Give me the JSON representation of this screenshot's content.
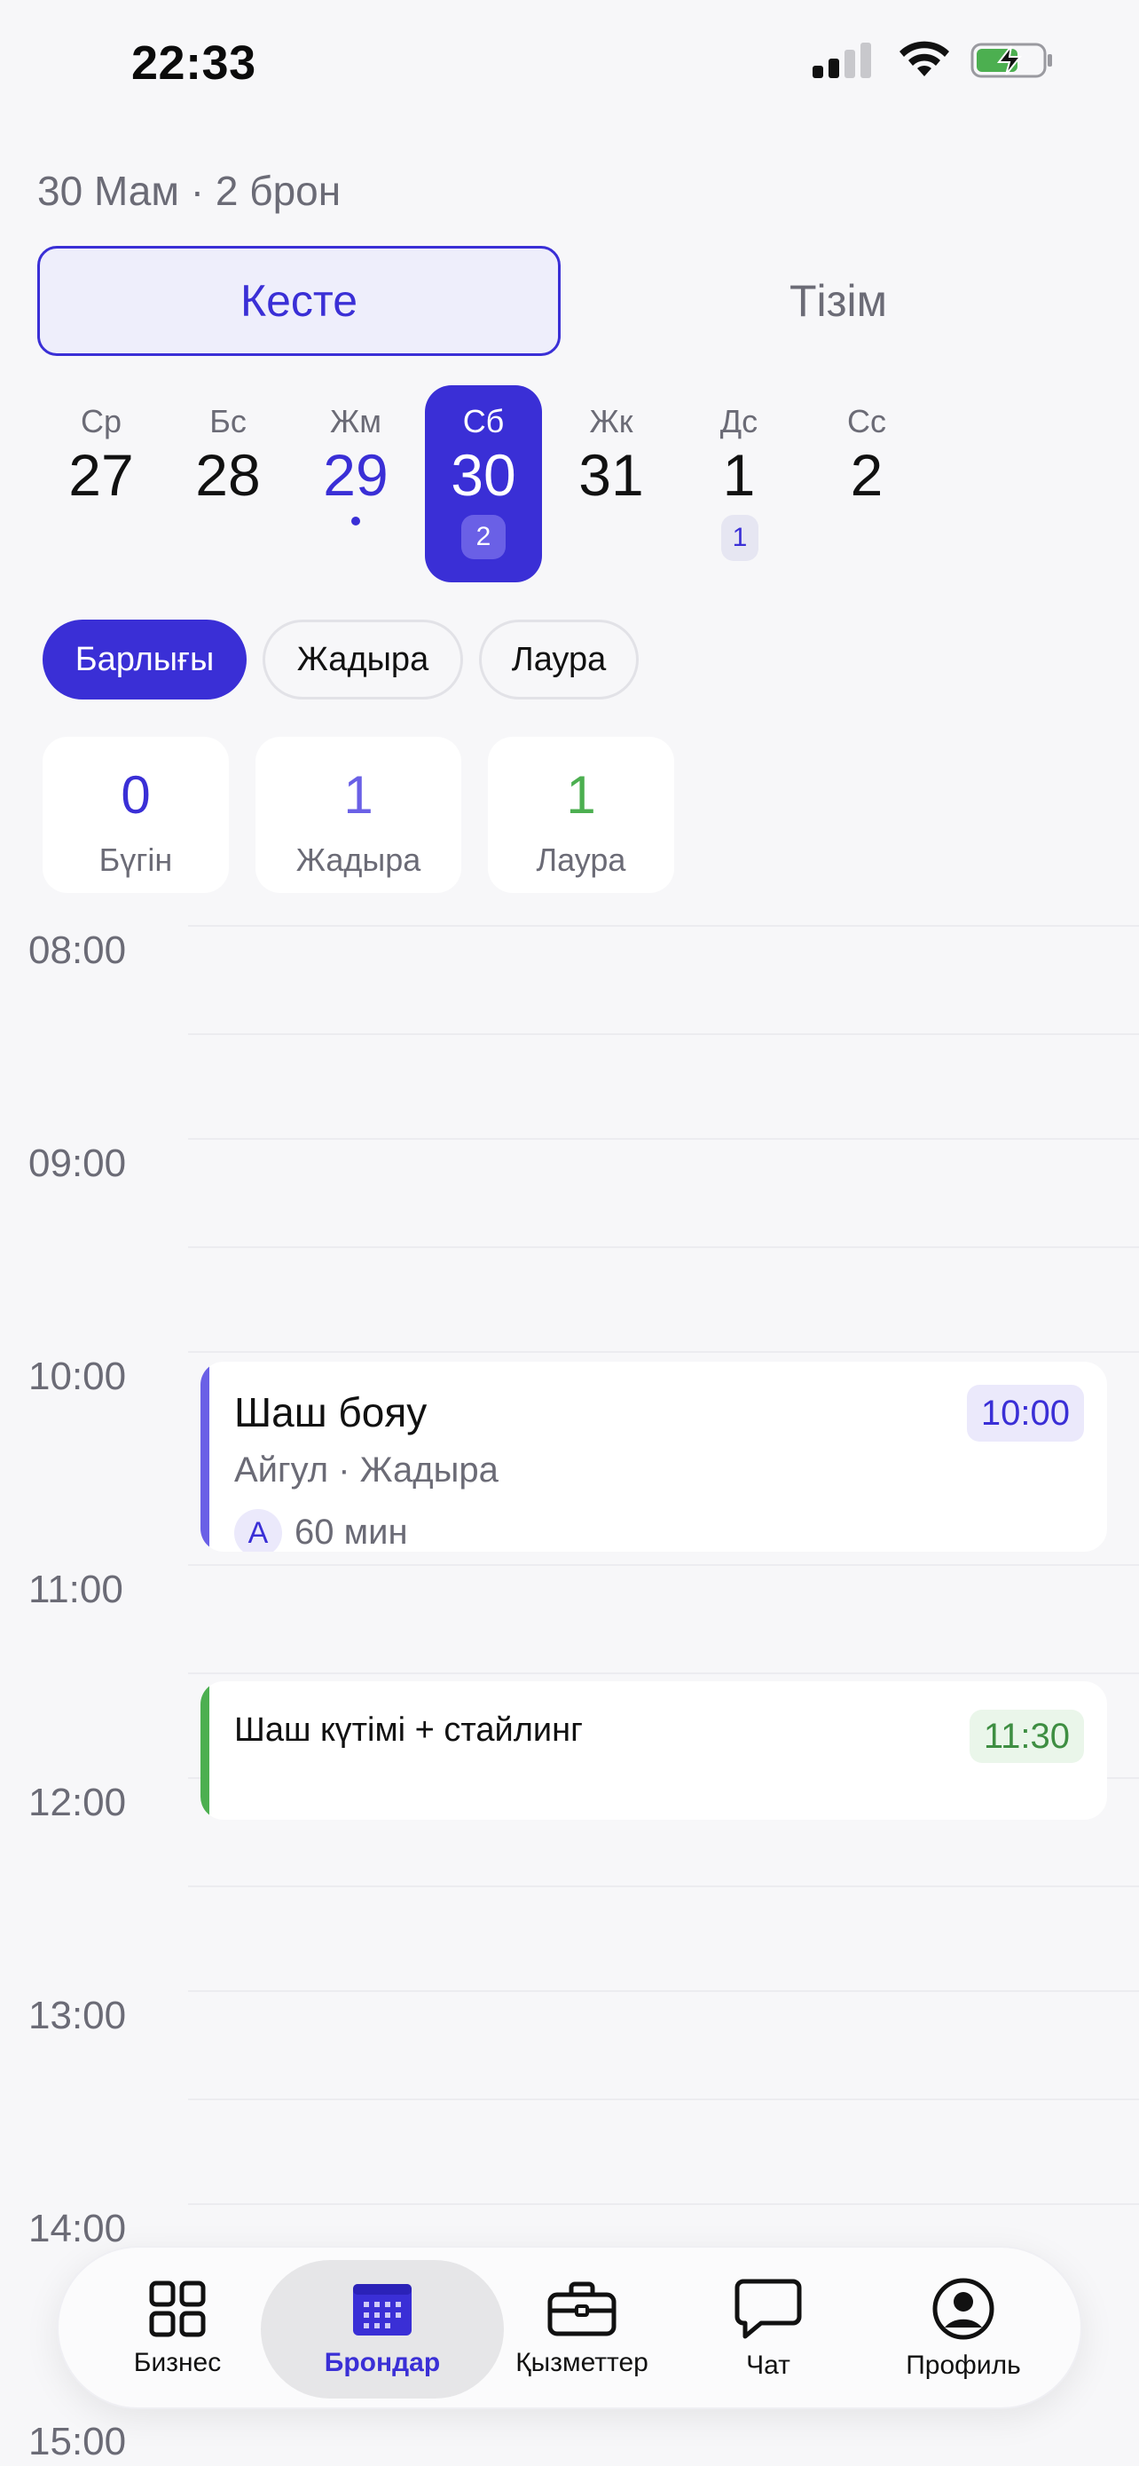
{
  "status_bar": {
    "time": "22:33"
  },
  "header": {
    "subtitle": "30 Мам · 2 брон"
  },
  "view_toggle": {
    "schedule_label": "Кесте",
    "list_label": "Тізім"
  },
  "week": [
    {
      "name": "Ср",
      "num": "27"
    },
    {
      "name": "Бс",
      "num": "28"
    },
    {
      "name": "Жм",
      "num": "29"
    },
    {
      "name": "Сб",
      "num": "30",
      "count": "2"
    },
    {
      "name": "Жк",
      "num": "31"
    },
    {
      "name": "Дс",
      "num": "1",
      "count": "1"
    },
    {
      "name": "Сс",
      "num": "2"
    }
  ],
  "filters": [
    "Барлығы",
    "Жадыра",
    "Лаура"
  ],
  "stats": [
    {
      "value": "0",
      "label": "Бүгін",
      "color": "#3a2fd6"
    },
    {
      "value": "1",
      "label": "Жадыра",
      "color": "#6a60e6"
    },
    {
      "value": "1",
      "label": "Лаура",
      "color": "#4caf50"
    }
  ],
  "timeline": {
    "hours": [
      "08:00",
      "09:00",
      "10:00",
      "11:00",
      "12:00",
      "13:00",
      "14:00",
      "15:00"
    ]
  },
  "events": [
    {
      "title": "Шаш бояу",
      "subtitle": "Айгул · Жадыра",
      "avatar": "А",
      "duration": "60 мин",
      "time": "10:00",
      "accent": "#6a60e6"
    },
    {
      "title": "Шаш күтімі + стайлинг",
      "time": "11:30",
      "accent": "#4caf50"
    }
  ],
  "nav": [
    {
      "label": "Бизнес",
      "icon": "grid-icon"
    },
    {
      "label": "Брондар",
      "icon": "calendar-icon"
    },
    {
      "label": "Қызметтер",
      "icon": "briefcase-icon"
    },
    {
      "label": "Чат",
      "icon": "chat-icon"
    },
    {
      "label": "Профиль",
      "icon": "profile-icon"
    }
  ]
}
